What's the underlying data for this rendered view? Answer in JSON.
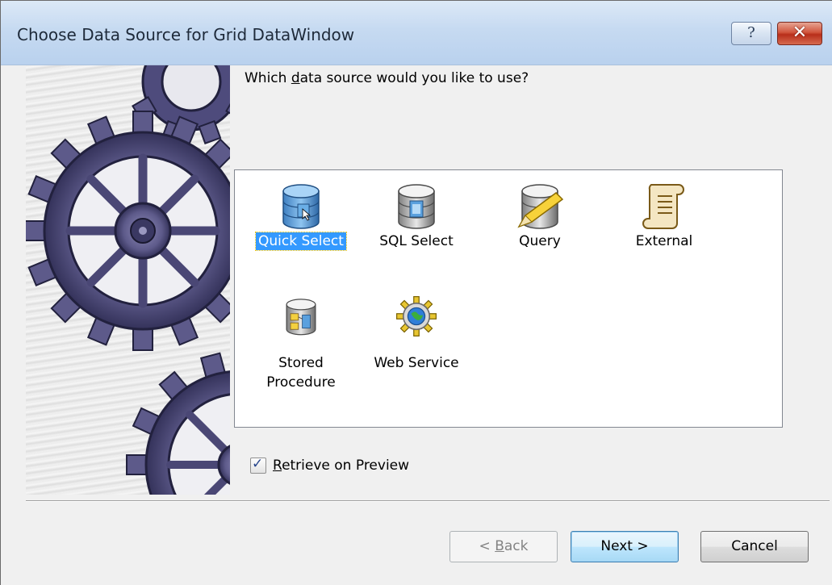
{
  "window": {
    "title": "Choose Data Source for Grid DataWindow",
    "help_button": "?",
    "close_button": "✕"
  },
  "prompt": {
    "before": "Which ",
    "accel": "d",
    "after": "ata source would you like to use?"
  },
  "data_sources": [
    {
      "label": "Quick Select",
      "icon": "quick-select-database-icon",
      "selected": true
    },
    {
      "label": "SQL Select",
      "icon": "sql-select-database-icon",
      "selected": false
    },
    {
      "label": "Query",
      "icon": "query-database-pencil-icon",
      "selected": false
    },
    {
      "label": "External",
      "icon": "external-scroll-icon",
      "selected": false
    },
    {
      "label_line1": "Stored",
      "label_line2": "Procedure",
      "icon": "stored-procedure-database-icon",
      "selected": false
    },
    {
      "label": "Web Service",
      "icon": "web-service-globe-icon",
      "selected": false
    }
  ],
  "retrieve_on_preview": {
    "checked": true,
    "accel": "R",
    "label_rest": "etrieve on Preview"
  },
  "buttons": {
    "back_prefix": "< ",
    "back_accel": "B",
    "back_rest": "ack",
    "next": "Next >",
    "cancel": "Cancel"
  },
  "colors": {
    "selection": "#3399ff",
    "gear": "#5d5a8a",
    "titlebar": "#c6daf1"
  }
}
